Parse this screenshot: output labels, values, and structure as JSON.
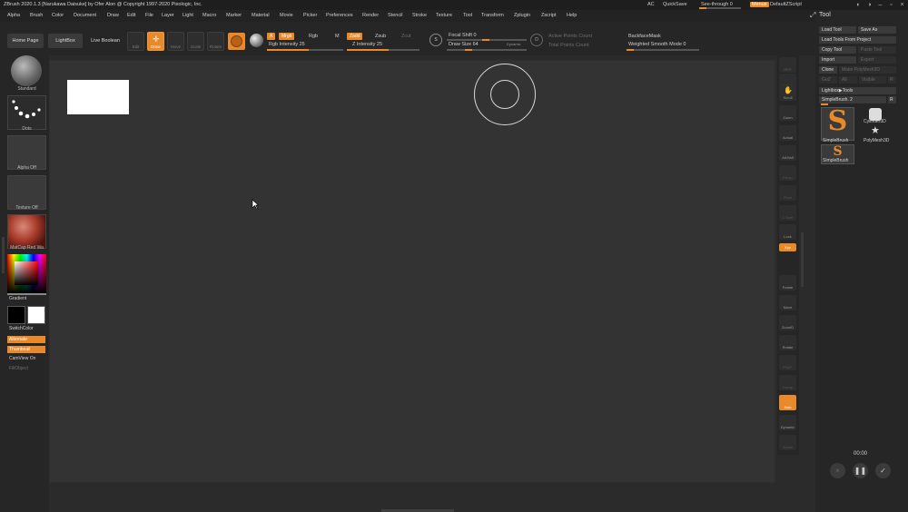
{
  "app": {
    "title": "ZBrush 2020.1.3 [Narukawa Daisuke] by Ofer Alon @ Copyright 1997-2020 Pixologic, Inc."
  },
  "titlebar": {
    "ac": "AC",
    "quicksave": "QuickSave",
    "see_through": "See-through  0",
    "menus": "Menus",
    "default_zscript": "DefaultZScript"
  },
  "menubar": {
    "items": [
      "Alpha",
      "Brush",
      "Color",
      "Document",
      "Draw",
      "Edit",
      "File",
      "Layer",
      "Light",
      "Macro",
      "Marker",
      "Material",
      "Movie",
      "Picker",
      "Preferences",
      "Render",
      "Stencil",
      "Stroke",
      "Texture",
      "Tool",
      "Transform",
      "Zplugin",
      "Zscript",
      "Help"
    ]
  },
  "toolbar": {
    "home_page": "Home Page",
    "lightbox": "LightBox",
    "live_boolean": "Live Boolean",
    "modes": [
      "Edit",
      "Draw",
      "Move",
      "Scale",
      "Rotate"
    ],
    "a_label": "A",
    "mrgb": "Mrgb",
    "rgb": "Rgb",
    "m": "M",
    "rgb_intensity": "Rgb Intensity 25",
    "zadd": "Zadd",
    "zsub": "Zsub",
    "zcut": "Zcut",
    "z_intensity": "Z Intensity 25",
    "focal_shift": "Focal Shift 0",
    "draw_size": "Draw Size 64",
    "dynamic": "Dynamic",
    "active_points": "Active Points Count",
    "total_points": "Total Points Count",
    "backface_mask": "BackfaceMask",
    "weighted_smooth": "Weighted Smooth Mode 0"
  },
  "leftshelf": {
    "standard": "Standard",
    "dots": "Dots",
    "alpha_off": "Alpha Off",
    "texture_off": "Texture Off",
    "matcap": "MatCap Red Wa",
    "gradient": "Gradient",
    "switch_color": "SwitchColor",
    "alternate": "Alternate",
    "thumbnail": "Thumbnail",
    "camview": "CamView On",
    "fillobject": "FillObject"
  },
  "rightshelf": {
    "items": [
      "BPR",
      "SPix 3",
      "Scroll",
      "Zoom",
      "Actual",
      "AAHalf",
      "Persp",
      "Floor",
      "L.Sym",
      "Lock",
      "Xyz",
      "Frame",
      "Move",
      "ZoomD",
      "Rotate",
      "PolyF",
      "Transp",
      "Solo",
      "Dynamic",
      "Xpose"
    ]
  },
  "toolpanel": {
    "title": "Tool",
    "load_tool": "Load Tool",
    "save_as": "Save As",
    "load_from_project": "Load Tools From Project",
    "copy_tool": "Copy Tool",
    "paste_tool": "Paste Tool",
    "import": "Import",
    "export": "Export",
    "clone": "Clone",
    "make_polymesh": "Make PolyMesh3D",
    "goz": "GoZ",
    "all": "All",
    "visible": "Visible",
    "r": "R",
    "lightbox_tools": "Lightbox▶Tools",
    "simplebrush_slider": "SimpleBrush. 2",
    "tools": [
      "SimpleBrush",
      "Cylinder3D",
      "PolyMesh3D",
      "SimpleBrush"
    ]
  },
  "recording": {
    "time": "00:00"
  },
  "colors": {
    "accent": "#e8892a",
    "background": "#2b2b2b",
    "canvas": "#333333"
  }
}
